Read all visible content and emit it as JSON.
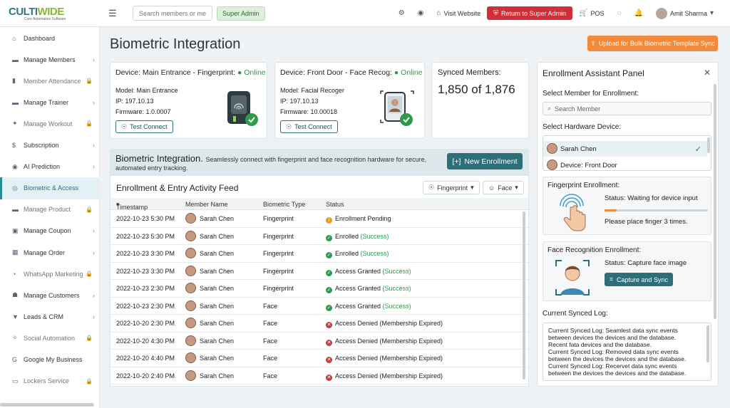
{
  "app": {
    "logo_prefix": "CULTI",
    "logo_accent": "WIDE",
    "logo_tagline": "Core Automation Software"
  },
  "topbar": {
    "search_placeholder": "Search members or mem",
    "role_badge": "Super Admin",
    "visit_website": "Visit Website",
    "return_admin": "Return to Super Admin",
    "pos": "POS",
    "user_name": "Amit Sharma"
  },
  "sidebar": {
    "items": [
      {
        "label": "Dashboard",
        "icon": "⌂",
        "chevron": false,
        "lock": false,
        "muted": false
      },
      {
        "label": "Manage Members",
        "icon": "▬",
        "chevron": true,
        "lock": false,
        "muted": false
      },
      {
        "label": "Member Attendance",
        "icon": "▮",
        "chevron": false,
        "lock": true,
        "muted": true
      },
      {
        "label": "Manage Trainer",
        "icon": "▬",
        "chevron": true,
        "lock": false,
        "muted": false
      },
      {
        "label": "Manage Workout",
        "icon": "✦",
        "chevron": false,
        "lock": true,
        "muted": true
      },
      {
        "label": "Subscription",
        "icon": "$",
        "chevron": true,
        "lock": false,
        "muted": false
      },
      {
        "label": "AI Prediction",
        "icon": "◉",
        "chevron": true,
        "lock": false,
        "muted": false
      },
      {
        "label": "Biometric & Access",
        "icon": "◎",
        "chevron": false,
        "lock": false,
        "muted": false,
        "active": true
      },
      {
        "label": "Manage Product",
        "icon": "▬",
        "chevron": false,
        "lock": true,
        "muted": true
      },
      {
        "label": "Manage Coupon",
        "icon": "▣",
        "chevron": true,
        "lock": false,
        "muted": false
      },
      {
        "label": "Manage Order",
        "icon": "▦",
        "chevron": true,
        "lock": false,
        "muted": false
      },
      {
        "label": "WhatsApp Marketing",
        "icon": "◔",
        "chevron": false,
        "lock": true,
        "muted": true
      },
      {
        "label": "Manage Customers",
        "icon": "☗",
        "chevron": true,
        "lock": false,
        "muted": false
      },
      {
        "label": "Leads & CRM",
        "icon": "▼",
        "chevron": true,
        "lock": false,
        "muted": false
      },
      {
        "label": "Social Automation",
        "icon": "✧",
        "chevron": false,
        "lock": true,
        "muted": true
      },
      {
        "label": "Google My Business",
        "icon": "G",
        "chevron": false,
        "lock": false,
        "muted": false
      },
      {
        "label": "Lockers Service",
        "icon": "▭",
        "chevron": false,
        "lock": true,
        "muted": true
      }
    ]
  },
  "page": {
    "title": "Biometric Integration",
    "bulk_sync_button": "Upload for Bulk Biometric Template Sync"
  },
  "devices": [
    {
      "title": "Device: Main Entrance - Fingerprint:",
      "status": "Online",
      "model": "Model: Main Entrance",
      "ip": "IP: 197.10.13",
      "firmware": "Firmware: 1.0.0007",
      "button": "Test Connect"
    },
    {
      "title": "Device: Front Door - Face Recog:",
      "status": "Online",
      "model": "Model: Facial Recoger",
      "ip": "IP: 197.10.13",
      "firmware": "Firmware: 10.00018",
      "button": "Test Connect"
    }
  ],
  "synced": {
    "label": "Synced Members:",
    "value": "1,850 of 1,876"
  },
  "banner": {
    "title": "Biometric Integration.",
    "desc": "Seamlessly connect with fingerprint and face recognition hardware for secure,",
    "line2": "automated entry tracking.",
    "new_button": "New Enrollment"
  },
  "feed": {
    "title": "Enrollment & Entry Activity Feed",
    "filters": [
      "Fingerprint",
      "Face"
    ],
    "columns": [
      "Timestamp",
      "Member Name",
      "Biometric Type",
      "Status"
    ],
    "rows": [
      {
        "ts": "2022-10-23 5:30 PM",
        "name": "Sarah Chen",
        "type": "Fingerprint",
        "status": "Enrollment Pending",
        "extra": "",
        "kind": "pend"
      },
      {
        "ts": "2022-10-23 5:30 PM",
        "name": "Sarah Chen",
        "type": "Fingerprint",
        "status": "Enrolled",
        "extra": "(Success)",
        "kind": "ok"
      },
      {
        "ts": "2022-10-23 3:30 PM",
        "name": "Sarah Chen",
        "type": "Fingerprint",
        "status": "Enrolled",
        "extra": "(Success)",
        "kind": "ok"
      },
      {
        "ts": "2022-10-23 3:30 PM",
        "name": "Sarah Chen",
        "type": "Fingerprint",
        "status": "Access Granted",
        "extra": "(Success)",
        "kind": "ok"
      },
      {
        "ts": "2022-10-23 2:30 PM",
        "name": "Sarah Chen",
        "type": "Fingerprint",
        "status": "Access Granted",
        "extra": "(Success)",
        "kind": "ok"
      },
      {
        "ts": "2022-10-23 2:30 PM",
        "name": "Sarah Chen",
        "type": "Face",
        "status": "Access Granted",
        "extra": "(Success)",
        "kind": "ok"
      },
      {
        "ts": "2022-10-20 2:30 PM",
        "name": "Sarah Chen",
        "type": "Face",
        "status": "Access Denied (Membership Expired)",
        "extra": "",
        "kind": "bad"
      },
      {
        "ts": "2022-10-20 4:30 PM",
        "name": "Sarah Chen",
        "type": "Face",
        "status": "Access Denied (Membership Expired)",
        "extra": "",
        "kind": "bad"
      },
      {
        "ts": "2022-10-20 4:40 PM",
        "name": "Sarah Chen",
        "type": "Face",
        "status": "Access Denied (Membership Expired)",
        "extra": "",
        "kind": "bad"
      },
      {
        "ts": "2022-10-20 2:40 PM",
        "name": "Sarah Chen",
        "type": "Face",
        "status": "Access Denied (Membership Expired)",
        "extra": "",
        "kind": "bad"
      }
    ]
  },
  "panel": {
    "title": "Enrollment Assistant Panel",
    "select_member_label": "Select Member for Enrollment:",
    "search_placeholder": "Search Member",
    "select_device_label": "Select Hardware Device:",
    "device_options": [
      "Sarah Chen",
      "Device: Front Door"
    ],
    "fingerprint": {
      "title": "Fingerprint Enrollment:",
      "status": "Status: Waiting for device input",
      "progress": 0.12,
      "hint": "Please place finger 3 times."
    },
    "face": {
      "title": "Face Recognition Enrollment:",
      "status": "Status: Capture face image",
      "button": "Capture and Sync"
    },
    "log_label": "Current Synced Log:",
    "log_lines": [
      "Current Synced Log: Seamlest data sync events between devices the devices and the database.",
      "Recent fata devices and the database.",
      "Current Synced Log: Removed data sync events between the devices the devices and the database.",
      "Current Synced Log: Recervet data sync events between the devices the devices and the database."
    ]
  }
}
